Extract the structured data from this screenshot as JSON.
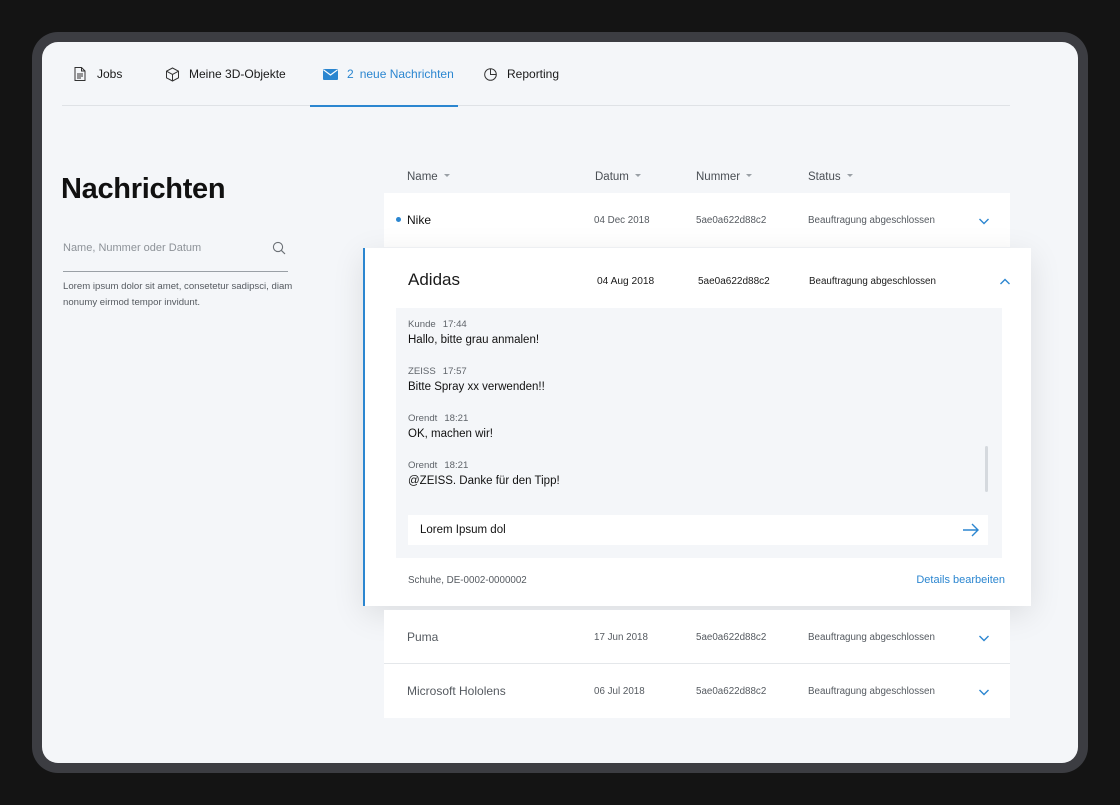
{
  "nav": {
    "tabs": [
      {
        "label": "Jobs",
        "icon": "document-icon"
      },
      {
        "label": "Meine 3D-Objekte",
        "icon": "cube-icon"
      },
      {
        "count": "2",
        "label": "neue Nachrichten",
        "icon": "mail-icon",
        "active": true
      },
      {
        "label": "Reporting",
        "icon": "pie-chart-icon"
      }
    ]
  },
  "sidebar": {
    "title": "Nachrichten",
    "search_placeholder": "Name, Nummer oder Datum",
    "description": "Lorem ipsum dolor sit amet, consetetur sadipsci, diam nonumy eirmod tempor invidunt."
  },
  "table": {
    "columns": [
      "Name",
      "Datum",
      "Nummer",
      "Status"
    ],
    "rows": [
      {
        "name": "Nike",
        "date": "04 Dec 2018",
        "number": "5ae0a622d88c2",
        "status": "Beauftragung abgeschlossen",
        "unread": true
      },
      {
        "name": "Adidas",
        "date": "04 Aug 2018",
        "number": "5ae0a622d88c2",
        "status": "Beauftragung abgeschlossen",
        "expanded": true
      },
      {
        "name": "Puma",
        "date": "17 Jun 2018",
        "number": "5ae0a622d88c2",
        "status": "Beauftragung abgeschlossen"
      },
      {
        "name": "Microsoft Hololens",
        "date": "06 Jul 2018",
        "number": "5ae0a622d88c2",
        "status": "Beauftragung abgeschlossen"
      }
    ]
  },
  "expanded": {
    "messages": [
      {
        "sender": "Kunde",
        "time": "17:44",
        "text": "Hallo, bitte grau anmalen!"
      },
      {
        "sender": "ZEISS",
        "time": "17:57",
        "text": "Bitte Spray xx verwenden!!"
      },
      {
        "sender": "Orendt",
        "time": "18:21",
        "text": "OK, machen wir!"
      },
      {
        "sender": "Orendt",
        "time": "18:21",
        "text": "@ZEISS. Danke für den Tipp!"
      }
    ],
    "reply_value": "Lorem Ipsum dol",
    "footer_info": "Schuhe, DE-0002-0000002",
    "details_link": "Details bearbeiten"
  },
  "colors": {
    "accent": "#2b86d0",
    "background": "#f4f6f9",
    "frame": "#3c3d42"
  }
}
